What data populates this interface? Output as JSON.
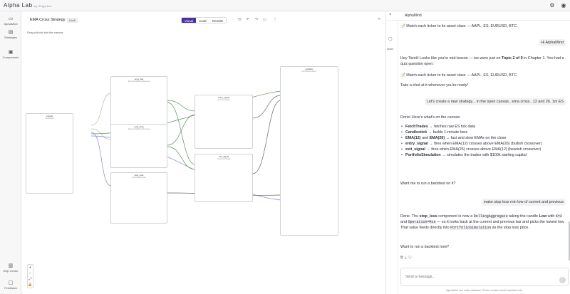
{
  "app": {
    "brand": "Alpha Lab",
    "brand_by": "by Edgebot"
  },
  "rail": {
    "items": [
      {
        "label": "AlphaMind",
        "icon": "chat-icon"
      },
      {
        "label": "Strategies",
        "icon": "folder-icon"
      },
      {
        "label": "Components",
        "icon": "cube-icon"
      },
      {
        "label": "Help Center",
        "icon": "book-icon"
      },
      {
        "label": "Feedback",
        "icon": "feedback-icon"
      }
    ]
  },
  "editor": {
    "title": "EMA Cross Strategy",
    "status": "Draft",
    "tabs": [
      "Visual",
      "Code",
      "Results"
    ],
    "active_tab": "Visual",
    "hint": "Drag a block into the canvas",
    "zoom_controls": [
      "+",
      "−",
      "⤢",
      "🔒"
    ],
    "nodes": [
      {
        "title": "candel",
        "sub": "Candlestick"
      },
      {
        "title": "ema_fast",
        "sub": "ExponentialMovingAverage"
      },
      {
        "title": "ema_slow",
        "sub": "ExponentialMovingAverage"
      },
      {
        "title": "stop_loss",
        "sub": "RollingAggregate"
      },
      {
        "title": "entry_signal",
        "sub": "CrossoverSignal"
      },
      {
        "title": "exit_signal",
        "sub": "CrossoverSignal"
      },
      {
        "title": "portfolio",
        "sub": "PortfolioSimulation"
      }
    ]
  },
  "chat": {
    "title": "AlphaMind",
    "sidebar_label": "Notes",
    "messages": {
      "a1": "📝 Match each ticker to its asset class — AAPL, ES, EURUSD, BTC.",
      "u1": "Hi AlphaMind",
      "a2_1": "Hey Tarek! Looks like you're mid-lesson — we were just on",
      "a2_bold": "Topic 2 of 9",
      "a2_2": "in Chapter 1. You had a quiz question open:",
      "a3": "📝 Match each ticker to its asset class — AAPL, ES, EURUSD, BTC.",
      "a4": "Take a shot at it whenever you're ready!",
      "u2": "Let's create a new strategy... in the open canvas.. ema cross.. 12 and 26. 1m ES",
      "a5": "Done! Here's what's on the canvas:",
      "bullets": [
        {
          "b": "FetchTrades",
          "t": " → fetches raw ES tick data"
        },
        {
          "b": "Candlestick",
          "t": " → builds 1-minute bars"
        },
        {
          "b": "EMA(12)",
          "mid": " and ",
          "b2": "EMA(26)",
          "t": " → fast and slow EMAs on the close"
        },
        {
          "b": "entry_signal",
          "t": " → fires when EMA(12) crosses above EMA(26) (bullish crossover)"
        },
        {
          "b": "exit_signal",
          "t": " → fires when EMA(26) crosses above EMA(12) (bearish crossover)"
        },
        {
          "b": "PortfolioSimulation",
          "t": " → simulates the trades with $100k starting capital"
        }
      ],
      "a6": "Want me to run a backtest on it?",
      "u3": "make stop loss min low of current and previous",
      "a7_1": "Done. The ",
      "a7_b1": "stop_loss",
      "a7_2": " component is now a ",
      "a7_code1": "RollingAggregate",
      "a7_3": " taking the candle ",
      "a7_b2": "Low",
      "a7_4": " with ",
      "a7_code2": "K=2",
      "a7_5": " and ",
      "a7_code3": "Operation=Min",
      "a7_6": " — so it looks back at the current and previous bar and picks the lowest low. That value feeds directly into ",
      "a7_code4": "PortfolioSimulation",
      "a7_7": " as the stop loss price.",
      "a8": "Want to run a backtest now?"
    },
    "input_placeholder": "Send a message...",
    "disclaimer": "AlphaMind can make mistakes. Please double-check important info."
  }
}
